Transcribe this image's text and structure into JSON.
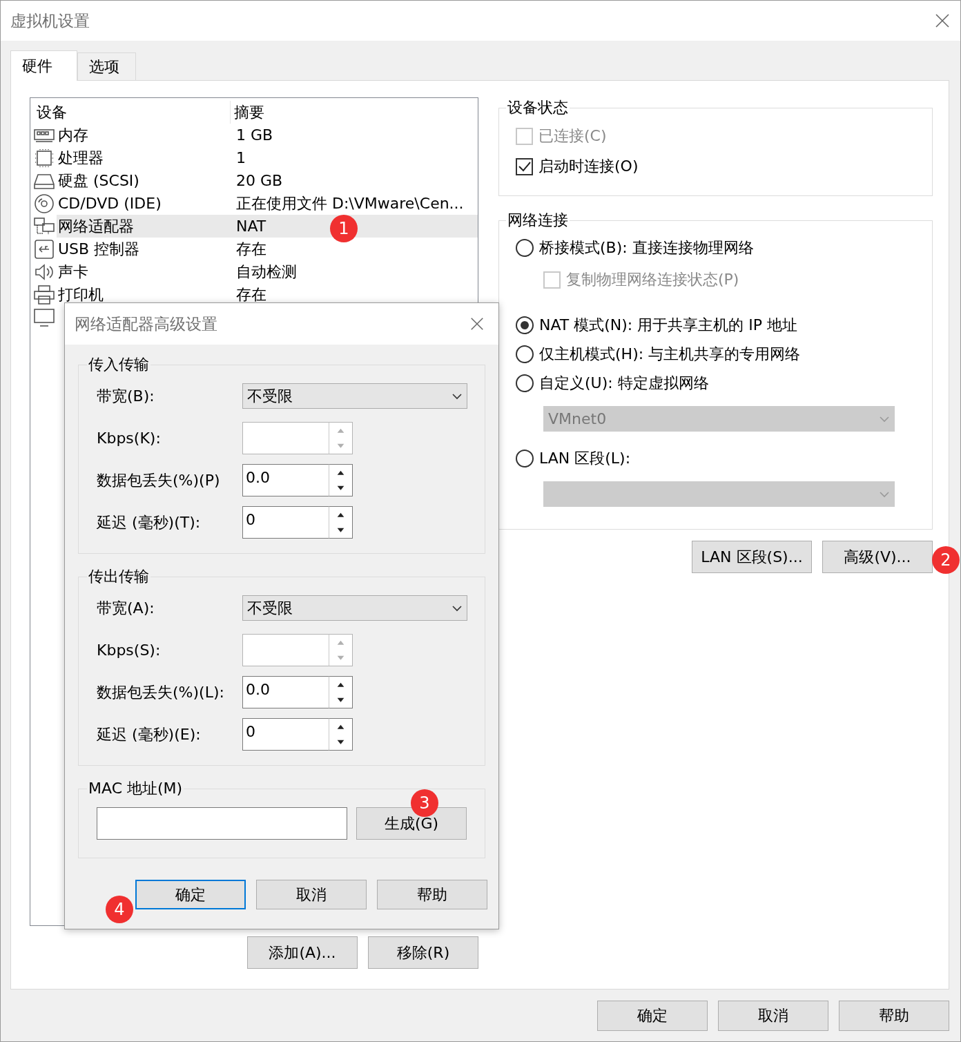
{
  "window": {
    "title": "虚拟机设置"
  },
  "tabs": [
    {
      "label": "硬件",
      "selected": true
    },
    {
      "label": "选项",
      "selected": false
    }
  ],
  "device_table": {
    "columns": [
      "设备",
      "摘要"
    ],
    "rows": [
      {
        "kind": "memory",
        "device": "内存",
        "summary": "1 GB",
        "selected": false
      },
      {
        "kind": "cpu",
        "device": "处理器",
        "summary": "1",
        "selected": false
      },
      {
        "kind": "disk",
        "device": "硬盘 (SCSI)",
        "summary": "20 GB",
        "selected": false
      },
      {
        "kind": "cd",
        "device": "CD/DVD (IDE)",
        "summary": "正在使用文件 D:\\VMware\\Cen...",
        "selected": false
      },
      {
        "kind": "network",
        "device": "网络适配器",
        "summary": "NAT",
        "selected": true
      },
      {
        "kind": "usb",
        "device": "USB 控制器",
        "summary": "存在",
        "selected": false
      },
      {
        "kind": "sound",
        "device": "声卡",
        "summary": "自动检测",
        "selected": false
      },
      {
        "kind": "printer",
        "device": "打印机",
        "summary": "存在",
        "selected": false
      },
      {
        "kind": "display",
        "selected": false
      }
    ]
  },
  "device_buttons": [
    "添加(A)...",
    "移除(R)"
  ],
  "device_status": {
    "title": "设备状态",
    "options": [
      {
        "label": "已连接(C)",
        "checked": false,
        "disabled": true
      },
      {
        "label": "启动时连接(O)",
        "checked": true,
        "disabled": false
      }
    ]
  },
  "network": {
    "title": "网络连接",
    "options": [
      {
        "kind": "radio",
        "label": "桥接模式(B): 直接连接物理网络",
        "selected": false
      },
      {
        "kind": "checkbox",
        "label": "复制物理网络连接状态(P)",
        "checked": false,
        "disabled": true
      },
      {
        "kind": "radio",
        "label": "NAT 模式(N): 用于共享主机的 IP 地址",
        "selected": true
      },
      {
        "kind": "radio",
        "label": "仅主机模式(H): 与主机共享的专用网络",
        "selected": false
      },
      {
        "kind": "radio",
        "label": "自定义(U): 特定虚拟网络",
        "selected": false
      },
      {
        "kind": "select",
        "value": "VMnet0",
        "disabled": true
      },
      {
        "kind": "radio",
        "label": "LAN 区段(L):",
        "selected": false
      },
      {
        "kind": "select",
        "disabled": true
      }
    ]
  },
  "network_buttons": [
    "LAN 区段(S)...",
    "高级(V)..."
  ],
  "dialog_buttons": [
    "确定",
    "取消",
    "帮助"
  ],
  "advanced_dialog": {
    "title": "网络适配器高级设置",
    "groups": [
      {
        "title": "传入传输",
        "fields": [
          {
            "kind": "select",
            "label": "带宽(B):",
            "value": "不受限"
          },
          {
            "kind": "spin",
            "label": "Kbps(K):",
            "disabled": true
          },
          {
            "kind": "spin",
            "label": "数据包丢失(%)(P)",
            "value": "0.0",
            "disabled": false
          },
          {
            "kind": "spin",
            "label": "延迟 (毫秒)(T):",
            "value": "0",
            "disabled": false
          }
        ]
      },
      {
        "title": "传出传输",
        "fields": [
          {
            "kind": "select",
            "label": "带宽(A):",
            "value": "不受限"
          },
          {
            "kind": "spin",
            "label": "Kbps(S):",
            "disabled": true
          },
          {
            "kind": "spin",
            "label": "数据包丢失(%)(L):",
            "value": "0.0",
            "disabled": false
          },
          {
            "kind": "spin",
            "label": "延迟 (毫秒)(E):",
            "value": "0",
            "disabled": false
          }
        ]
      }
    ],
    "mac": {
      "title": "MAC 地址(M)",
      "button": "生成(G)"
    },
    "buttons": [
      {
        "label": "确定",
        "focused": true
      },
      {
        "label": "取消",
        "focused": false
      },
      {
        "label": "帮助",
        "focused": false
      }
    ]
  },
  "badges": [
    {
      "label": "1"
    },
    {
      "label": "2"
    },
    {
      "label": "3"
    },
    {
      "label": "4"
    }
  ]
}
